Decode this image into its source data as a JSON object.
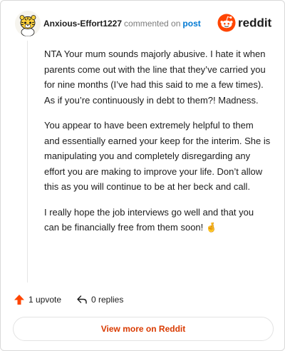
{
  "comment": {
    "author": "Anxious-Effort1227",
    "action_text": "commented on",
    "post_link": "post",
    "avatar_icon": "snoo-tiger-avatar-icon",
    "paragraphs": [
      "NTA Your mum sounds majorly abusive. I hate it when parents come out with the line that they’ve carried you for nine months (I’ve had this said to me a few times). As if you’re continuously in debt to them?! Madness.",
      "You appear to have been extremely helpful to them and essentially earned your keep for the interim. She is manipulating you and completely disregarding any effort you are making to improve your life. Don’t allow this as you will continue to be at her beck and call.",
      "I really hope the job interviews go well and that you can be financially free from them soon! 🤞"
    ]
  },
  "brand": {
    "name": "reddit",
    "icon": "reddit-snoo-icon",
    "color": "#ff4500"
  },
  "actions": {
    "upvote_label": "1 upvote",
    "upvote_icon": "upvote-arrow-icon",
    "upvote_color": "#ff4500",
    "replies_label": "0 replies",
    "replies_icon": "reply-arrow-icon"
  },
  "footer": {
    "view_more_label": "View more on Reddit",
    "view_more_color": "#d93a00"
  }
}
